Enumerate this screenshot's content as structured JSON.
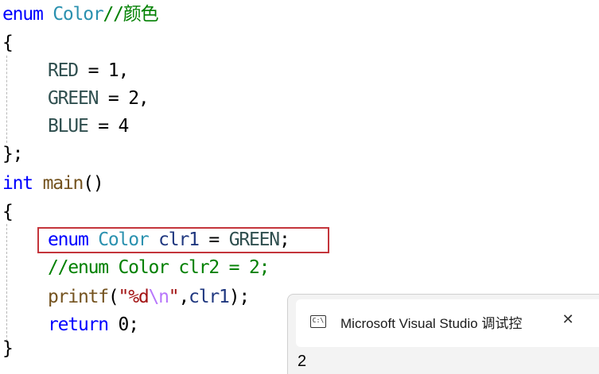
{
  "code": {
    "l1": {
      "kw": "enum",
      "type": "Color",
      "comment": "//颜色"
    },
    "l2": {
      "brace": "{"
    },
    "l3": {
      "name": "RED",
      "op": " = ",
      "val": "1",
      "punct": ","
    },
    "l4": {
      "name": "GREEN",
      "op": " = ",
      "val": "2",
      "punct": ","
    },
    "l5": {
      "name": "BLUE",
      "op": " = ",
      "val": "4"
    },
    "l6": {
      "text": "};"
    },
    "l7": {
      "kw": "int",
      "fn": "main",
      "paren": "()"
    },
    "l8": {
      "brace": "{"
    },
    "l9": {
      "kw": "enum",
      "type": "Color",
      "var": "clr1",
      "op": " = ",
      "val": "GREEN",
      "punct": ";"
    },
    "l10": {
      "comment": "//enum Color clr2 = 2;"
    },
    "l11": {
      "fn": "printf",
      "open": "(",
      "q1": "\"",
      "fmt": "%d",
      "esc": "\\n",
      "q2": "\"",
      "sep": ",",
      "arg": "clr1",
      "close": ");"
    },
    "l12": {
      "kw": "return",
      "val": "0",
      "punct": ";"
    },
    "l13": {
      "brace": "}"
    }
  },
  "console": {
    "icon_label": "C:\\",
    "title": "Microsoft Visual Studio 调试控",
    "close": "✕",
    "output": "2"
  }
}
